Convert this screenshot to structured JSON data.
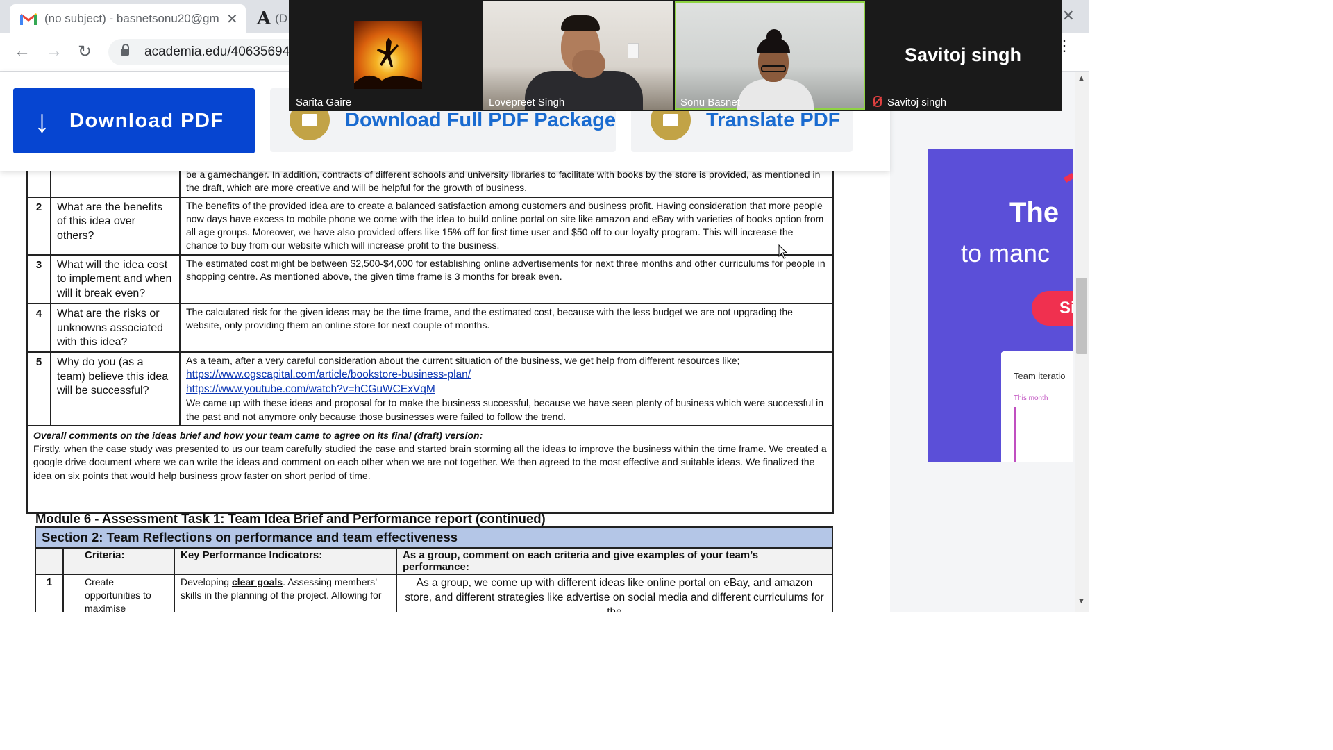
{
  "browser": {
    "tabs": [
      {
        "title": "(no subject) - basnetsonu20@gm"
      },
      {
        "title": "(D"
      }
    ],
    "url": "academia.edu/40635694"
  },
  "download_bar": {
    "download_pdf": "Download PDF",
    "full_package": "Download Full PDF Package",
    "translate": "Translate PDF"
  },
  "zoom": {
    "participants": [
      {
        "name": "Sarita Gaire"
      },
      {
        "name": "Lovepreet Singh"
      },
      {
        "name": "Sonu Basnet"
      },
      {
        "name": "Savitoj singh",
        "display": "Savitoj singh",
        "muted": true
      }
    ]
  },
  "document": {
    "prev_row_tail": "be a gamechanger. In addition, contracts of different schools and university libraries to facilitate with books by the store is provided, as mentioned in the draft, which are more creative and will be helpful for the growth of business.",
    "rows": [
      {
        "num": "2",
        "question": "What are the benefits of this idea over others?",
        "answer": "The benefits of the provided idea are to create a balanced satisfaction among customers and business profit. Having consideration that more people now days have excess to mobile phone we come with the idea to build online portal on site like amazon and eBay with varieties of books option from all age groups. Moreover, we have also provided offers like 15% off for first time user and $50 off to our loyalty program. This will increase the chance to buy from our website which will increase profit to the business."
      },
      {
        "num": "3",
        "question": "What will the idea cost to implement and when will it break even?",
        "answer": "The estimated cost might be between $2,500-$4,000 for establishing online advertisements for next three months and other curriculums for people in shopping centre. As mentioned above, the given time frame is 3 months for break even."
      },
      {
        "num": "4",
        "question": "What are the risks or unknowns associated with this idea?",
        "answer": "The calculated risk for the given ideas may be the time frame, and the estimated cost, because with the less budget we are not upgrading the website, only providing them an online store for next couple of months."
      },
      {
        "num": "5",
        "question": "Why do you (as a team) believe this idea will be successful?",
        "answer_intro": "As a team, after a very careful consideration about the current situation of the business, we get help from different resources like;",
        "link1": "https://www.ogscapital.com/article/bookstore-business-plan/",
        "link2": "https://www.youtube.com/watch?v=hCGuWCExVqM",
        "answer_outro": "We came up with these ideas and proposal for to make the business successful, because we have seen plenty of business which were successful in the past and not anymore only because those businesses were failed to follow the trend."
      }
    ],
    "overall_heading": "Overall comments on the ideas brief and how your team came to agree on its final (draft) version:",
    "overall_text": "Firstly, when the case study was presented to us our team carefully studied the case and started brain storming all the ideas to improve the business within the time frame. We created a google drive document where we can write the ideas and comment on each other when we are not together. We then agreed to the most effective and suitable ideas. We finalized the idea on six points that would help business grow faster on short period of time.",
    "module_title": "Module 6 - Assessment Task 1: Team Idea Brief and Performance report (continued)",
    "section2": {
      "title": "Section 2: Team Reflections on performance and team effectiveness",
      "headers": [
        "Criteria:",
        "Key Performance Indicators:",
        "As a group, comment on each criteria and give examples of your team’s performance:"
      ],
      "row1": {
        "num": "1",
        "criteria": "Create opportunities to maximise",
        "kpi_pre": "Developing ",
        "kpi_bold": "clear goals",
        "kpi_post": ". Assessing members’ skills in the planning of the project. Allowing for",
        "comment": "As a group, we come up with different ideas like online portal on eBay, and amazon store, and different strategies like advertise on social media and different curriculums for the"
      }
    }
  },
  "ad": {
    "heading": "The",
    "subheading": "to manc",
    "button": "Si",
    "card_title": "Team iteratio",
    "card_sub": "This month"
  },
  "colors": {
    "download_blue": "#0645d1",
    "link_blue": "#1a6bd0",
    "lock_gold": "#c2a346",
    "section_header": "#b4c6e7",
    "ad_purple": "#5b4fd8",
    "ad_red": "#f0304f"
  }
}
